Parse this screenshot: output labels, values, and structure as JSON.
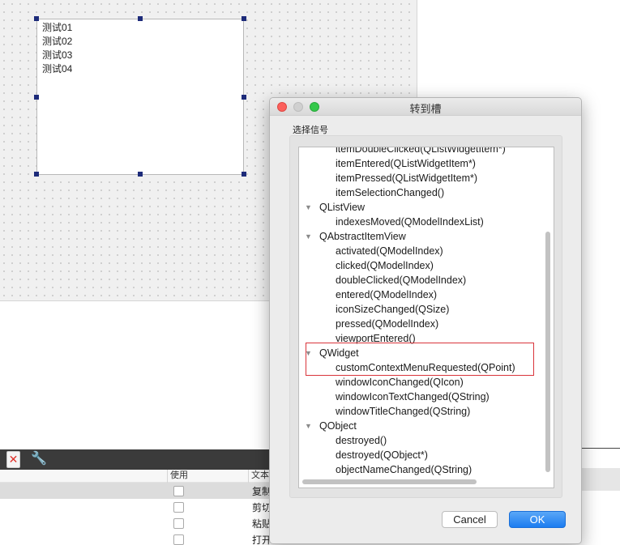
{
  "canvas": {
    "list_items": [
      "测试01",
      "测试02",
      "测试03",
      "测试04"
    ]
  },
  "toolbar": {
    "delete_icon_glyph": "✕",
    "wrench_icon_glyph": "🔧"
  },
  "table": {
    "headers": [
      "使用",
      "文本"
    ],
    "rows": [
      "复制",
      "剪切",
      "粘贴",
      "打开"
    ]
  },
  "dialog": {
    "title": "转到槽",
    "group_label": "选择信号",
    "tree": [
      {
        "kind": "child",
        "label": "itemDoubleClicked(QListWidgetItem*)"
      },
      {
        "kind": "child",
        "label": "itemEntered(QListWidgetItem*)"
      },
      {
        "kind": "child",
        "label": "itemPressed(QListWidgetItem*)"
      },
      {
        "kind": "child",
        "label": "itemSelectionChanged()"
      },
      {
        "kind": "parent",
        "label": "QListView"
      },
      {
        "kind": "child",
        "label": "indexesMoved(QModelIndexList)"
      },
      {
        "kind": "parent",
        "label": "QAbstractItemView"
      },
      {
        "kind": "child",
        "label": "activated(QModelIndex)"
      },
      {
        "kind": "child",
        "label": "clicked(QModelIndex)"
      },
      {
        "kind": "child",
        "label": "doubleClicked(QModelIndex)"
      },
      {
        "kind": "child",
        "label": "entered(QModelIndex)"
      },
      {
        "kind": "child",
        "label": "iconSizeChanged(QSize)"
      },
      {
        "kind": "child",
        "label": "pressed(QModelIndex)"
      },
      {
        "kind": "child",
        "label": "viewportEntered()"
      },
      {
        "kind": "parent",
        "label": "QWidget"
      },
      {
        "kind": "child",
        "label": "customContextMenuRequested(QPoint)"
      },
      {
        "kind": "child",
        "label": "windowIconChanged(QIcon)"
      },
      {
        "kind": "child",
        "label": "windowIconTextChanged(QString)"
      },
      {
        "kind": "child",
        "label": "windowTitleChanged(QString)"
      },
      {
        "kind": "parent",
        "label": "QObject"
      },
      {
        "kind": "child",
        "label": "destroyed()"
      },
      {
        "kind": "child",
        "label": "destroyed(QObject*)"
      },
      {
        "kind": "child",
        "label": "objectNameChanged(QString)"
      }
    ],
    "expand_arrow_glyph": "▼",
    "highlight_color": "#d9343b",
    "cancel_label": "Cancel",
    "ok_label": "OK"
  }
}
